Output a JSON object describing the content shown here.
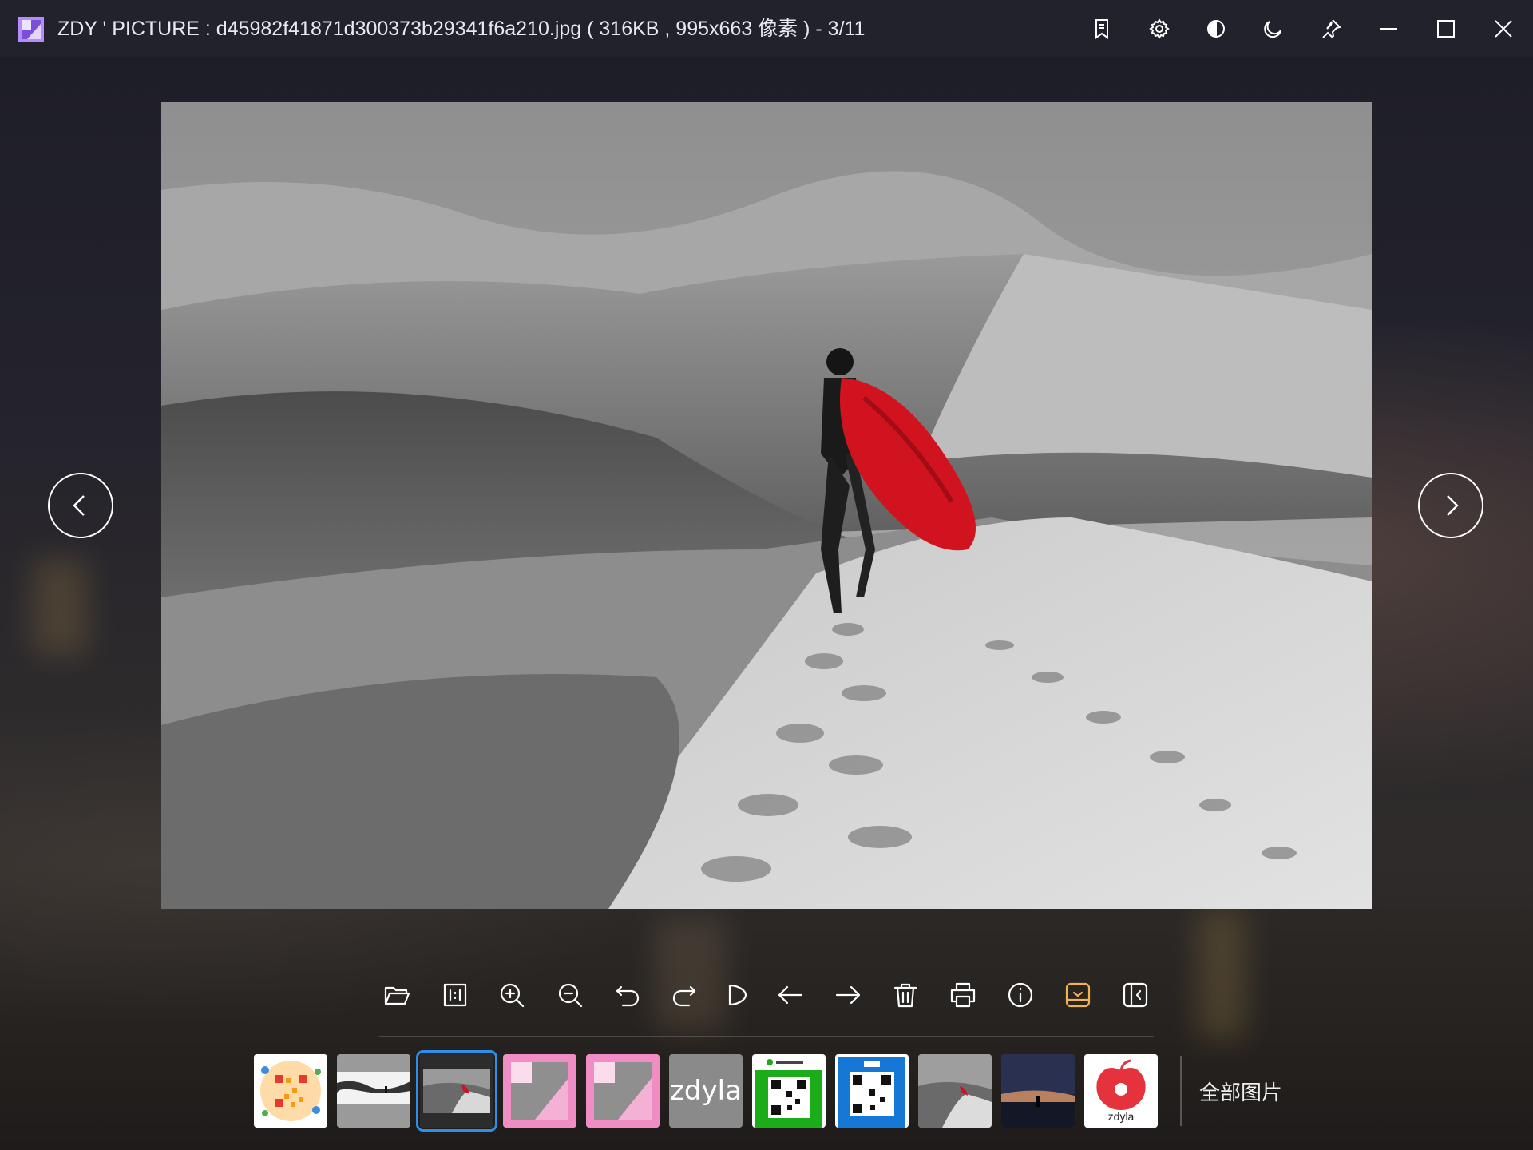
{
  "window": {
    "title": "ZDY ' PICTURE : d45982f41871d300373b29341f6a210.jpg ( 316KB , 995x663 像素 ) - 3/11",
    "controls": [
      "bookmark-icon",
      "gear-icon",
      "contrast-icon",
      "moon-icon",
      "pin-icon",
      "minimize-icon",
      "maximize-icon",
      "close-icon"
    ]
  },
  "toolbar": {
    "tools": [
      "open-folder",
      "actual-size",
      "zoom-in",
      "zoom-out",
      "rotate-left",
      "rotate-right",
      "flip",
      "previous",
      "next",
      "delete",
      "print",
      "info",
      "thumbnail-strip",
      "sidebar-toggle"
    ],
    "active_tool": "thumbnail-strip",
    "active_color": "#f3b24a"
  },
  "thumbnails": {
    "items": [
      {
        "name": "qr-colorful"
      },
      {
        "name": "snow-river"
      },
      {
        "name": "desert-red-cape"
      },
      {
        "name": "pink-logo-1"
      },
      {
        "name": "pink-logo-2"
      },
      {
        "name": "zdyla-text",
        "text": "zdyla"
      },
      {
        "name": "wechat-qr"
      },
      {
        "name": "alipay-qr"
      },
      {
        "name": "desert-red-cape-2"
      },
      {
        "name": "night-sky-person"
      },
      {
        "name": "zdyla-apple",
        "text": "zdyla"
      }
    ],
    "selected_index": 2,
    "all_images_label": "全部图片",
    "selection_color": "#2e8fe8"
  }
}
